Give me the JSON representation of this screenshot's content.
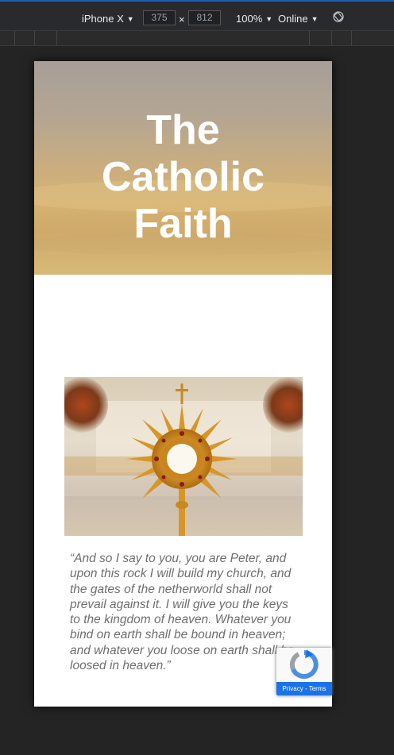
{
  "devtools": {
    "device": "iPhone X",
    "width": "375",
    "height": "812",
    "times": "×",
    "zoom": "100%",
    "network": "Online",
    "caret": "▼"
  },
  "hero": {
    "title_line1": "The",
    "title_line2": "Catholic",
    "title_line3": "Faith"
  },
  "quote": {
    "text": "“And so I say to you, you are Peter, and upon this rock I will build my church, and the gates of the netherworld shall not prevail against it. I will give you the keys to the kingdom of heaven. Whatever you bind on earth shall be bound in heaven; and whatever you loose on earth shall be loosed in heaven.”"
  },
  "recaptcha": {
    "privacy": "Privacy",
    "separator": " - ",
    "terms": "Terms"
  },
  "colors": {
    "devtools_bg": "#292a2d",
    "page_bg": "#242424",
    "hero_text": "#ffffff",
    "quote_text": "#6e6e6e"
  }
}
